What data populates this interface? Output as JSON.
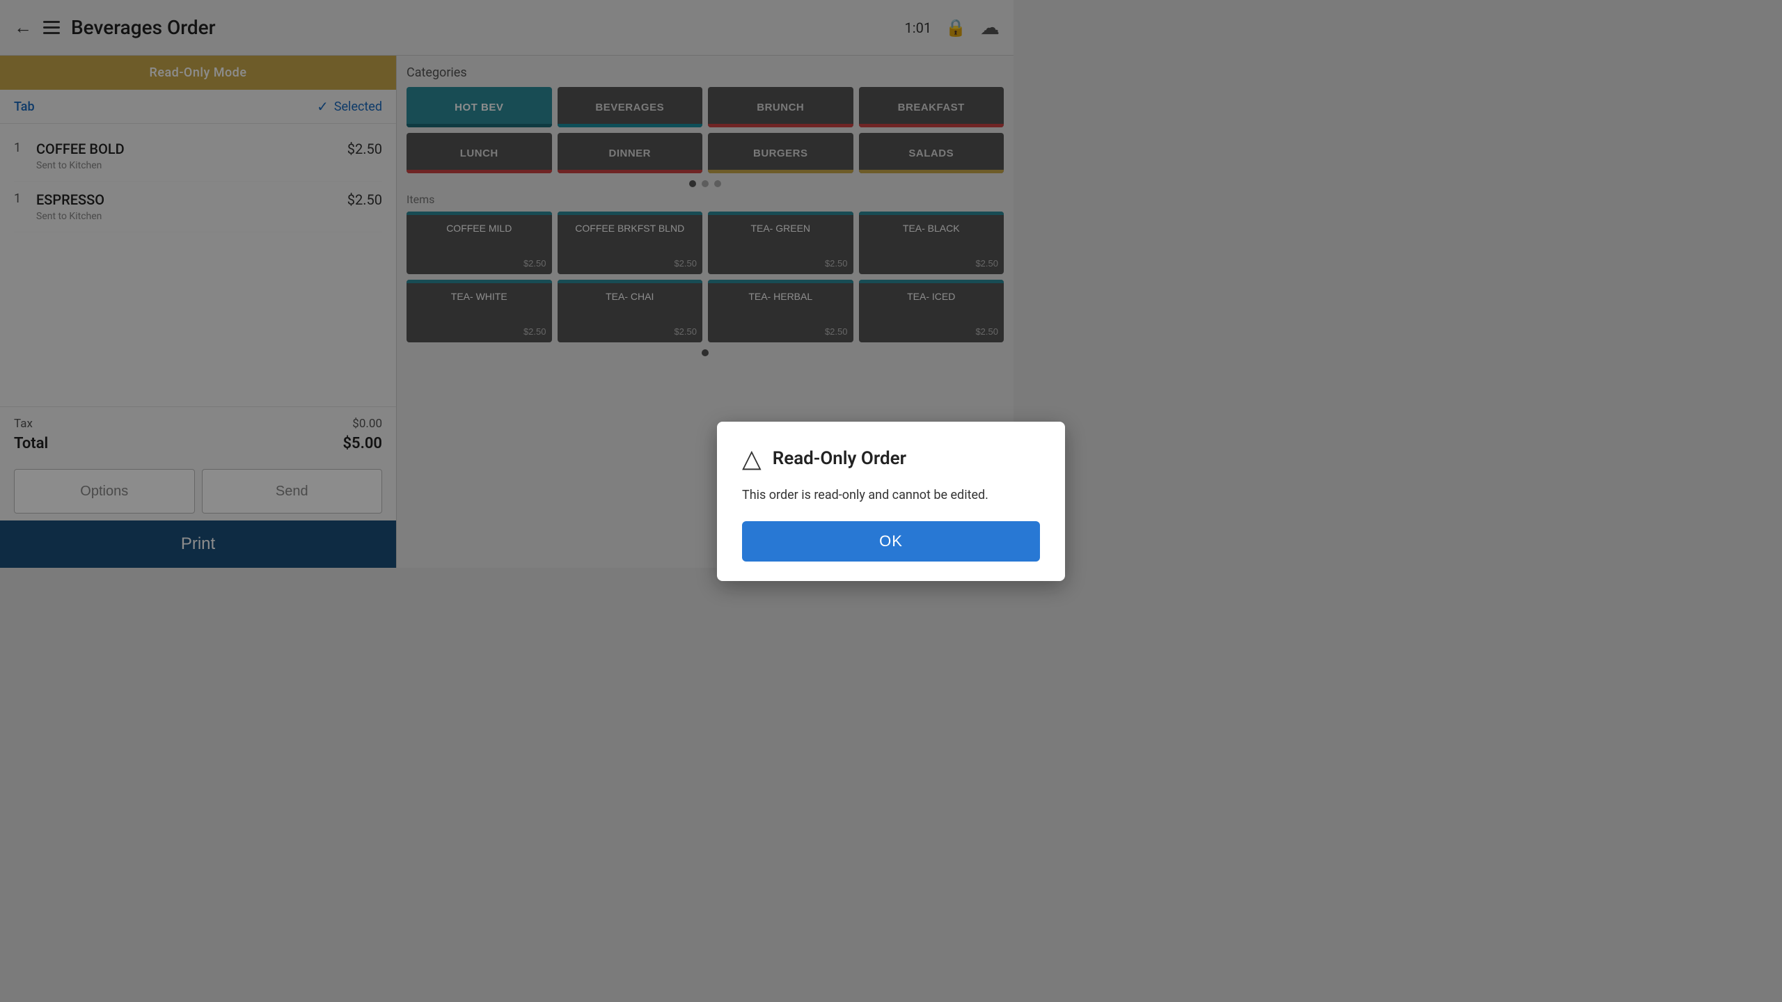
{
  "topbar": {
    "title": "Beverages Order",
    "time": "1:01"
  },
  "left": {
    "read_only_banner": "Read-Only Mode",
    "tab_label": "Tab",
    "selected_label": "Selected",
    "items": [
      {
        "qty": "1",
        "name": "COFFEE BOLD",
        "sub": "Sent to Kitchen",
        "price": "$2.50"
      },
      {
        "qty": "1",
        "name": "ESPRESSO",
        "sub": "Sent to Kitchen",
        "price": "$2.50"
      }
    ],
    "tax_label": "Tax",
    "tax_value": "$0.00",
    "total_label": "Total",
    "total_value": "$5.00",
    "btn_options": "Options",
    "btn_send": "Send",
    "btn_print": "Print"
  },
  "right": {
    "categories_label": "Categories",
    "categories": [
      {
        "id": "hot-bev",
        "label": "HOT BEV",
        "active": true
      },
      {
        "id": "beverages",
        "label": "BEVERAGES",
        "active": false
      },
      {
        "id": "brunch",
        "label": "BRUNCH",
        "active": false
      },
      {
        "id": "breakfast",
        "label": "BREAKFAST",
        "active": false
      },
      {
        "id": "lunch",
        "label": "LUNCH",
        "active": false
      },
      {
        "id": "dinner",
        "label": "DINNER",
        "active": false
      },
      {
        "id": "burgers",
        "label": "BURGERS",
        "active": false
      },
      {
        "id": "salads",
        "label": "SALADS",
        "active": false
      }
    ],
    "items_label": "Items",
    "items": [
      {
        "name": "COFFEE MILD",
        "price": "$2.50"
      },
      {
        "name": "COFFEE BRKFST BLND",
        "price": "$2.50"
      },
      {
        "name": "TEA- GREEN",
        "price": "$2.50"
      },
      {
        "name": "TEA- BLACK",
        "price": "$2.50"
      },
      {
        "name": "TEA- WHITE",
        "price": "$2.50"
      },
      {
        "name": "TEA- CHAI",
        "price": "$2.50"
      },
      {
        "name": "TEA- HERBAL",
        "price": "$2.50"
      },
      {
        "name": "TEA- ICED",
        "price": "$2.50"
      }
    ]
  },
  "dialog": {
    "title": "Read-Only Order",
    "message": "This order is read-only and cannot be edited.",
    "ok_label": "OK"
  }
}
